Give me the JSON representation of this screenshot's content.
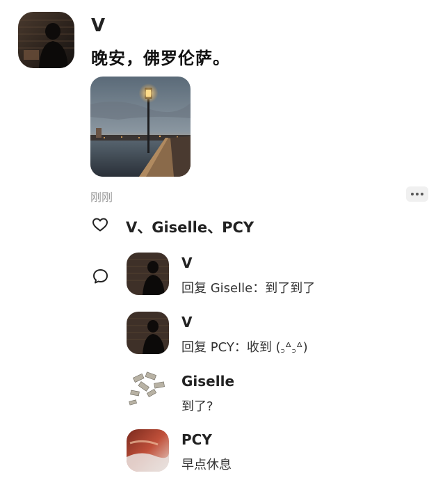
{
  "post": {
    "author": "V",
    "text": "晚安，佛罗伦萨。",
    "time": "刚刚"
  },
  "likes": {
    "names": "V、Giselle、PCY"
  },
  "comments": [
    {
      "name": "V",
      "text": "回复 Giselle：到了到了"
    },
    {
      "name": "V",
      "text": "回复 PCY：收到 (꜆ᐞ꜆ᐞ)"
    },
    {
      "name": "Giselle",
      "text": "到了?"
    },
    {
      "name": "PCY",
      "text": "早点休息"
    }
  ],
  "icons": {
    "heart": "heart-icon",
    "comment": "comment-bubble-icon",
    "more": "more-dots-icon"
  }
}
